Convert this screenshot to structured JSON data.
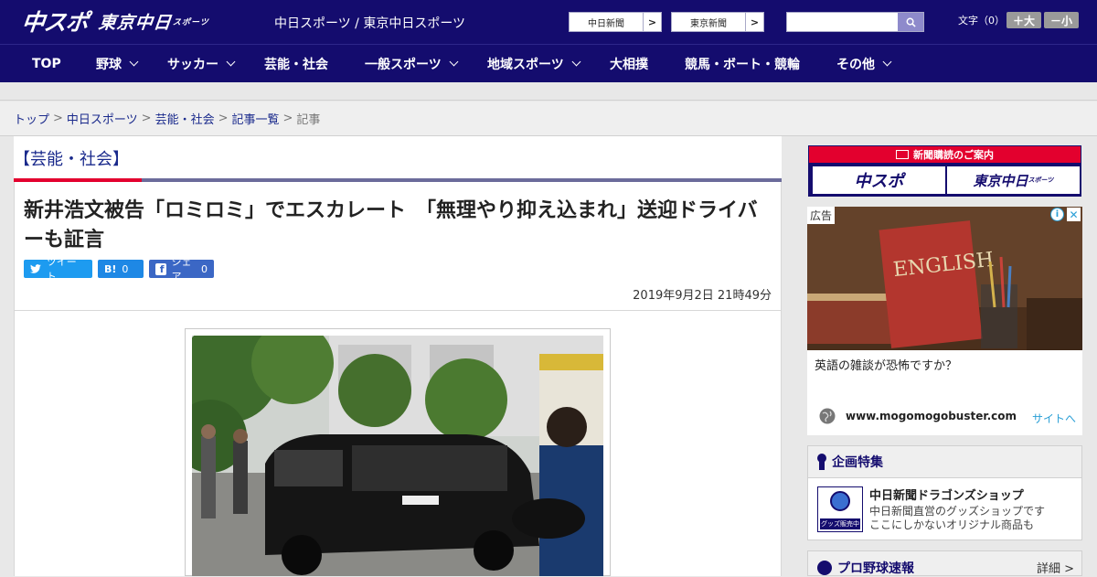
{
  "header": {
    "logo_chuspo": "中スポ",
    "logo_tokyo": "東京中日",
    "logo_tokyo_sub": "スポーツ",
    "site_title": "中日スポーツ / 東京中日スポーツ",
    "site_links": [
      {
        "label": "中日新聞",
        "arrow": ">"
      },
      {
        "label": "東京新聞",
        "arrow": ">"
      }
    ],
    "search_placeholder": "",
    "font_size_label": "文字（0）",
    "font_bigger": "＋大",
    "font_smaller": "－小",
    "brand_color": "#140c6e"
  },
  "nav": {
    "items": [
      {
        "label": "TOP",
        "dropdown": false
      },
      {
        "label": "野球",
        "dropdown": true
      },
      {
        "label": "サッカー",
        "dropdown": true
      },
      {
        "label": "芸能・社会",
        "dropdown": false
      },
      {
        "label": "一般スポーツ",
        "dropdown": true
      },
      {
        "label": "地域スポーツ",
        "dropdown": true
      },
      {
        "label": "大相撲",
        "dropdown": false
      },
      {
        "label": "競馬・ボート・競輪",
        "dropdown": false
      },
      {
        "label": "その他",
        "dropdown": true
      }
    ]
  },
  "breadcrumb": {
    "items": [
      "トップ",
      "中日スポーツ",
      "芸能・社会",
      "記事一覧"
    ],
    "current": "記事",
    "separator": ">"
  },
  "article": {
    "category": "【芸能・社会】",
    "headline": "新井浩文被告「ロミロミ」でエスカレート　「無理やり抑え込まれ」送迎ドライバーも証言",
    "share": {
      "tweet_label": "ツイート",
      "hatena_label": "B!",
      "hatena_count": "0",
      "facebook_label": "シェア",
      "facebook_count": "0"
    },
    "date": "2019年9月2日 21時49分",
    "accent_color": "#e3002e"
  },
  "sidebar": {
    "subscription": {
      "title": "新聞購読のご案内",
      "chuspo": "中スポ",
      "tokyo": "東京中日",
      "tokyo_sub": "スポーツ"
    },
    "ad": {
      "label": "広告",
      "info": "i",
      "close": "✕",
      "book_title": "ENGLISH",
      "text": "英語の雑談が恐怖ですか？",
      "domain": "www.mogomogobuster.com",
      "visit": "サイトへ"
    },
    "feature": {
      "heading": "企画特集",
      "thumb_label": "グッズ販売中",
      "title": "中日新聞ドラゴンズショップ",
      "desc_line1": "中日新聞直営のグッズショップです",
      "desc_line2": "ここにしかないオリジナル商品も"
    },
    "baseball": {
      "heading": "プロ野球速報",
      "more": "詳細 >"
    }
  }
}
